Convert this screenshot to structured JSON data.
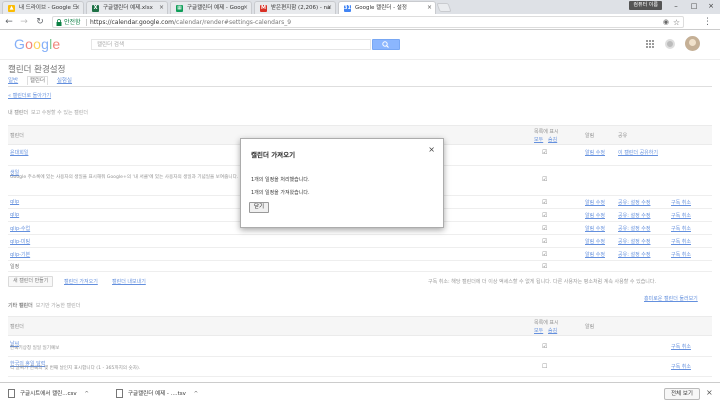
{
  "browser": {
    "tabs": [
      {
        "title": "내 드라이브 - Google 드",
        "icon": "drive-icon",
        "color": "#fbbc04"
      },
      {
        "title": "구글캘린더 예제.xlsx",
        "icon": "excel-icon",
        "color": "#1e7145"
      },
      {
        "title": "구글캘린더 예제 - Goog",
        "icon": "sheets-icon",
        "color": "#0f9d58"
      },
      {
        "title": "받은편지함 (2,206) - na",
        "icon": "gmail-icon",
        "color": "#d93025"
      },
      {
        "title": "Google 캘린더 - 설정",
        "icon": "calendar-icon",
        "color": "#4285f4"
      }
    ],
    "profile_name": "컴퓨터 이름",
    "secure_label": "안전함",
    "url_host": "https://calendar.google.com",
    "url_path": "/calendar/render#settings-calendars_9"
  },
  "header": {
    "logo": [
      "G",
      "o",
      "o",
      "g",
      "l",
      "e"
    ],
    "logo_colors": [
      "#4285f4",
      "#ea4335",
      "#fbbc05",
      "#4285f4",
      "#34a853",
      "#ea4335"
    ],
    "search_placeholder": "캘린더 검색"
  },
  "settings": {
    "title": "캘린더 환경설정",
    "tabs": [
      "일반",
      "캘린더",
      "실험실"
    ],
    "back_link": "« 캘린더로 돌아가기",
    "my_calendars_heading": "내 캘린더",
    "my_calendars_sub": "보고 수정할 수 있는 캘린더",
    "table_headers": {
      "calendar": "캘린더",
      "show_in_list": "목록에 표시",
      "show_all": "모두",
      "hide_all": "숨김",
      "notify": "알림",
      "share": "공유"
    },
    "rows": [
      {
        "name": "윤대희일",
        "desc": "",
        "notify": "알림 수정",
        "share1": "이 캘린더 공유하기",
        "share2": "",
        "unsub": ""
      },
      {
        "name": "생일",
        "desc": "Google 주소록에 있는 사용자의 생일을 표시해줘 Google+의 '내 서클'에 있는 사용자의 생일과 기념일을 보여줍니다. 이 캘린더에서 생일이나 기타 중요 날짜도 표시합니다.",
        "notify": "",
        "share1": "",
        "share2": "",
        "unsub": ""
      },
      {
        "name": "qlip",
        "desc": "",
        "notify": "알림 수정",
        "share1": "공유: 설정 수정",
        "share2": "",
        "unsub": "구독 취소"
      },
      {
        "name": "qlip",
        "desc": "",
        "notify": "알림 수정",
        "share1": "공유: 설정 수정",
        "share2": "",
        "unsub": "구독 취소"
      },
      {
        "name": "qlip-수업",
        "desc": "",
        "notify": "알림 수정",
        "share1": "공유: 설정 수정",
        "share2": "",
        "unsub": "구독 취소"
      },
      {
        "name": "qlip-미팅",
        "desc": "",
        "notify": "알림 수정",
        "share1": "공유: 설정 수정",
        "share2": "",
        "unsub": "구독 취소"
      },
      {
        "name": "qlip-기본",
        "desc": "",
        "notify": "알림 수정",
        "share1": "공유: 설정 수정",
        "share2": "",
        "unsub": "구독 취소"
      },
      {
        "name": "일정",
        "desc": "",
        "notify": "",
        "share1": "",
        "share2": "",
        "unsub": ""
      }
    ],
    "create_button": "새 캘린더 만들기",
    "import_link": "캘린더 가져오기",
    "export_link": "캘린더 내보내기",
    "bottom_note": "구독 취소: 해당 캘린더에 더 이상 액세스할 수 없게 됩니다. 다른 사용자는 평소처럼 계속 사용할 수 있습니다.",
    "more_link": "흥미로운 캘린더 둘러보기",
    "other_heading": "기타 캘린더",
    "other_sub": "보기만 가능한 캘린더",
    "other_headers": {
      "calendar": "캘린더",
      "show_in_list": "목록에 표시",
      "show_all": "모두",
      "hide_all": "숨김",
      "notify": "알림"
    },
    "other_rows": [
      {
        "name": "날씨",
        "desc": "한국기상청 일일 일기예보",
        "unsub": "구독 취소"
      },
      {
        "name": "한국의 휴일 달력",
        "desc": "각 날짜가 한국의 몇 번째 날인지 표시합니다 (1 - 365까지의 숫자).",
        "unsub": "구독 취소"
      }
    ]
  },
  "dialog": {
    "title": "캘린더 가져오기",
    "msg1": "1개의 일정을 처리했습니다.",
    "msg2": "1개의 일정을 가져왔습니다.",
    "ok": "닫기"
  },
  "downloads": {
    "items": [
      {
        "name": "구글시트에서 캘린...csv"
      },
      {
        "name": "구글캘린더 예제 - ....tsv"
      }
    ],
    "show_all": "전체 보기"
  }
}
